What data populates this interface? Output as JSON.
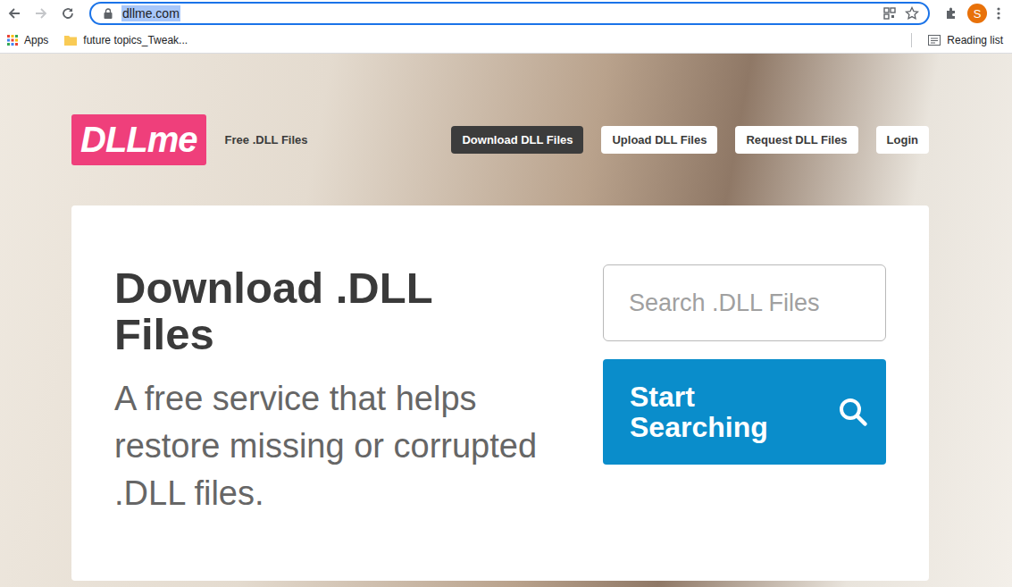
{
  "browser": {
    "url": "dllme.com",
    "url_selected": true,
    "back_disabled": false,
    "forward_disabled": true,
    "profile_initial": "S",
    "bookmarks": [
      {
        "label": "Apps",
        "kind": "apps"
      },
      {
        "label": "future topics_Tweak...",
        "kind": "folder"
      }
    ],
    "reading_list": "Reading list"
  },
  "site": {
    "logo": "DLLme",
    "tagline": "Free .DLL Files",
    "nav": [
      {
        "label": "Download DLL Files",
        "selected": true
      },
      {
        "label": "Upload DLL Files",
        "selected": false
      },
      {
        "label": "Request DLL Files",
        "selected": false
      },
      {
        "label": "Login",
        "selected": false
      }
    ]
  },
  "hero": {
    "title": "Download .DLL Files",
    "subtitle": "A free service that helps restore missing or corrupted .DLL files.",
    "search": {
      "placeholder": "Search .DLL Files"
    },
    "search_button": "Start Searching"
  }
}
